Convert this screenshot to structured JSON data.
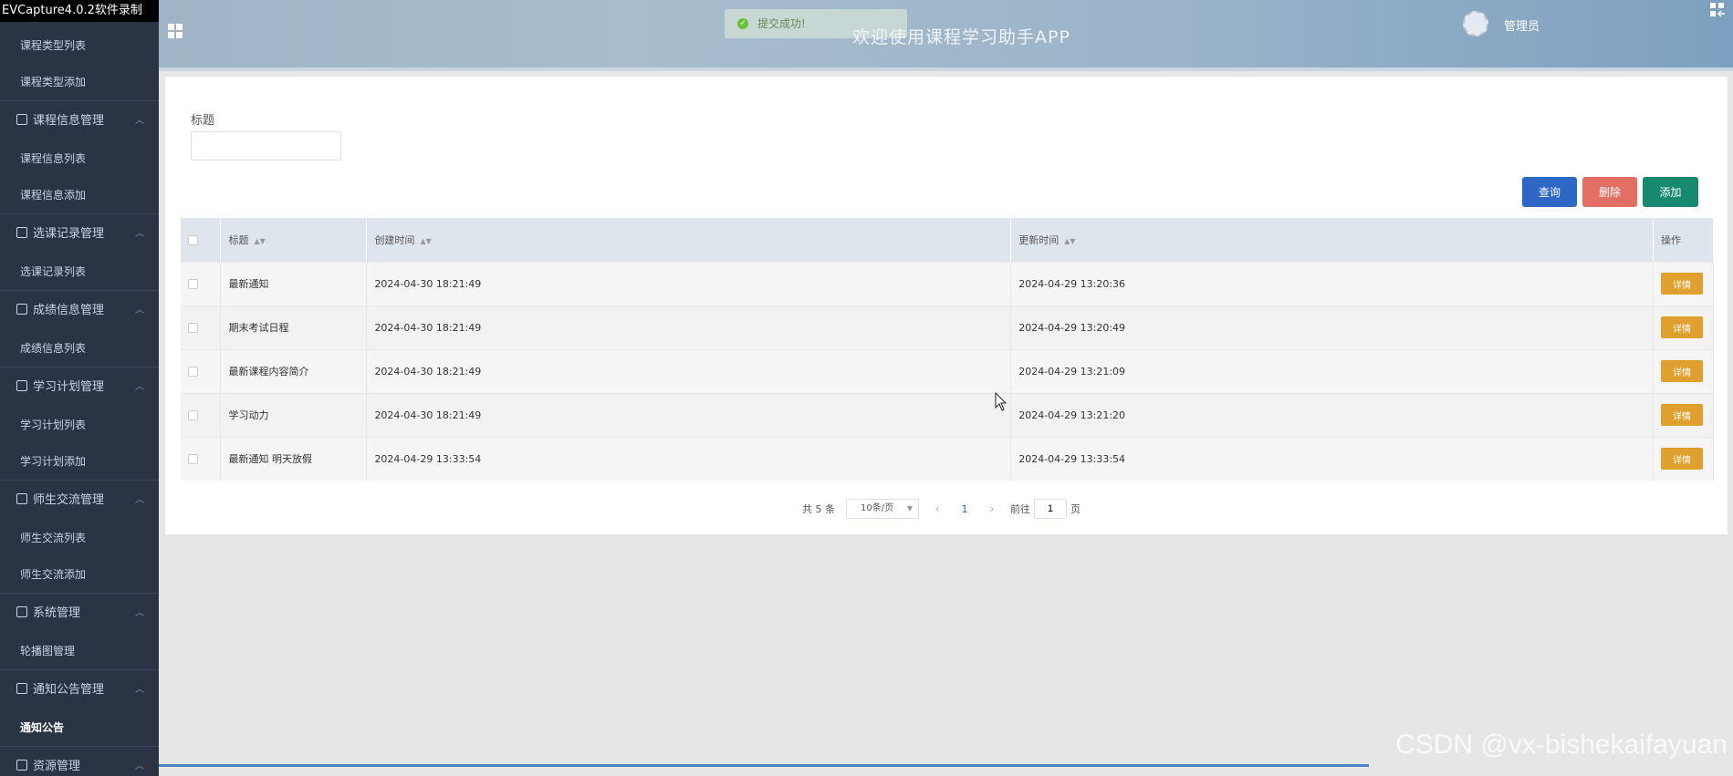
{
  "recorder": {
    "title": "EVCapture4.0.2软件录制"
  },
  "header": {
    "app_title": "欢迎使用课程学习助手APP",
    "toast": "提交成功!",
    "user": "管理员"
  },
  "sidebar": {
    "items": [
      {
        "kind": "item",
        "label": "课程类型列表"
      },
      {
        "kind": "item",
        "label": "课程类型添加"
      },
      {
        "kind": "group",
        "label": "课程信息管理"
      },
      {
        "kind": "item",
        "label": "课程信息列表"
      },
      {
        "kind": "item",
        "label": "课程信息添加"
      },
      {
        "kind": "group",
        "label": "选课记录管理"
      },
      {
        "kind": "item",
        "label": "选课记录列表"
      },
      {
        "kind": "group",
        "label": "成绩信息管理"
      },
      {
        "kind": "item",
        "label": "成绩信息列表"
      },
      {
        "kind": "group",
        "label": "学习计划管理"
      },
      {
        "kind": "item",
        "label": "学习计划列表"
      },
      {
        "kind": "item",
        "label": "学习计划添加"
      },
      {
        "kind": "group",
        "label": "师生交流管理"
      },
      {
        "kind": "item",
        "label": "师生交流列表"
      },
      {
        "kind": "item",
        "label": "师生交流添加"
      },
      {
        "kind": "group",
        "label": "系统管理"
      },
      {
        "kind": "item",
        "label": "轮播图管理"
      },
      {
        "kind": "group",
        "label": "通知公告管理"
      },
      {
        "kind": "item",
        "label": "通知公告",
        "active": true
      },
      {
        "kind": "group",
        "label": "资源管理"
      }
    ]
  },
  "filter": {
    "title_label": "标题",
    "title_value": ""
  },
  "actions": {
    "search": "查询",
    "delete": "删除",
    "add": "添加"
  },
  "table": {
    "headers": {
      "title": "标题",
      "created": "创建时间",
      "updated": "更新时间",
      "ops": "操作"
    },
    "detail_label": "详情",
    "rows": [
      {
        "title": "最新通知",
        "created": "2024-04-30 18:21:49",
        "updated": "2024-04-29 13:20:36"
      },
      {
        "title": "期末考试日程",
        "created": "2024-04-30 18:21:49",
        "updated": "2024-04-29 13:20:49"
      },
      {
        "title": "最新课程内容简介",
        "created": "2024-04-30 18:21:49",
        "updated": "2024-04-29 13:21:09"
      },
      {
        "title": "学习动力",
        "created": "2024-04-30 18:21:49",
        "updated": "2024-04-29 13:21:20"
      },
      {
        "title": "最新通知 明天放假",
        "created": "2024-04-29 13:33:54",
        "updated": "2024-04-29 13:33:54"
      }
    ]
  },
  "pagination": {
    "total": "共 5 条",
    "page_size": "10条/页",
    "current": "1",
    "goto_prefix": "前往",
    "goto_value": "1",
    "goto_suffix": "页"
  },
  "watermark": "CSDN @vx-bishekaifayuan"
}
